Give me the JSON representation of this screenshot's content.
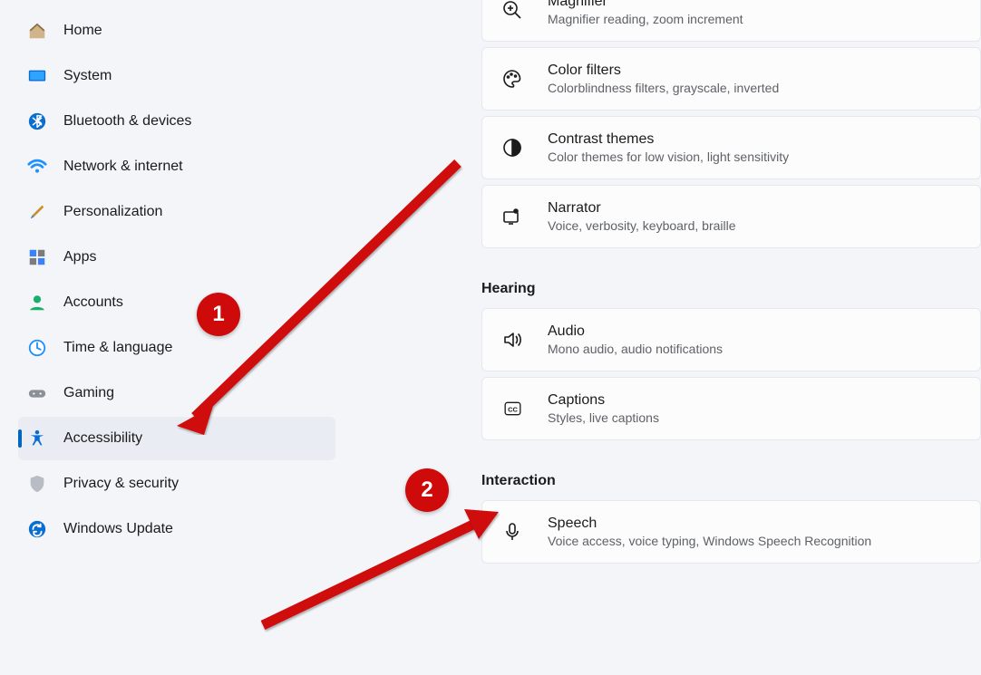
{
  "sidebar": {
    "items": [
      {
        "label": "Home"
      },
      {
        "label": "System"
      },
      {
        "label": "Bluetooth & devices"
      },
      {
        "label": "Network & internet"
      },
      {
        "label": "Personalization"
      },
      {
        "label": "Apps"
      },
      {
        "label": "Accounts"
      },
      {
        "label": "Time & language"
      },
      {
        "label": "Gaming"
      },
      {
        "label": "Accessibility"
      },
      {
        "label": "Privacy & security"
      },
      {
        "label": "Windows Update"
      }
    ]
  },
  "content": {
    "groups": [
      {
        "header": null,
        "items": [
          {
            "title": "Magnifier",
            "sub": "Magnifier reading, zoom increment"
          },
          {
            "title": "Color filters",
            "sub": "Colorblindness filters, grayscale, inverted"
          },
          {
            "title": "Contrast themes",
            "sub": "Color themes for low vision, light sensitivity"
          },
          {
            "title": "Narrator",
            "sub": "Voice, verbosity, keyboard, braille"
          }
        ]
      },
      {
        "header": "Hearing",
        "items": [
          {
            "title": "Audio",
            "sub": "Mono audio, audio notifications"
          },
          {
            "title": "Captions",
            "sub": "Styles, live captions"
          }
        ]
      },
      {
        "header": "Interaction",
        "items": [
          {
            "title": "Speech",
            "sub": "Voice access, voice typing, Windows Speech Recognition"
          }
        ]
      }
    ]
  },
  "annotations": {
    "badge1": "1",
    "badge2": "2"
  }
}
